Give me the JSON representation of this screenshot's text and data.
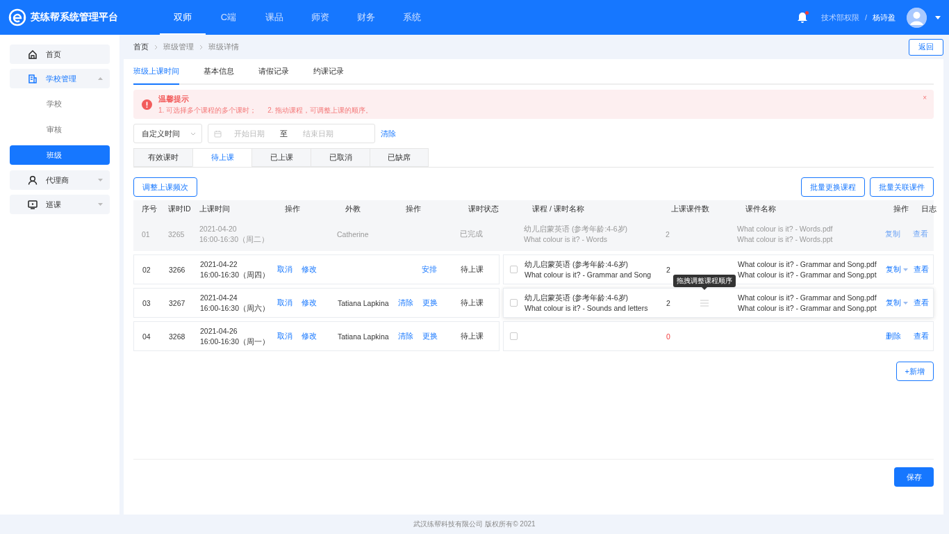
{
  "app": {
    "title": "英练帮系统管理平台"
  },
  "top_nav": [
    {
      "label": "双师",
      "selected": true
    },
    {
      "label": "C端",
      "selected": false
    },
    {
      "label": "课品",
      "selected": false
    },
    {
      "label": "师资",
      "selected": false
    },
    {
      "label": "财务",
      "selected": false
    },
    {
      "label": "系统",
      "selected": false
    }
  ],
  "user": {
    "notifications": true,
    "role": "技术部权限",
    "separator": "/",
    "name": "杨诗盈"
  },
  "sidebar": {
    "items": [
      {
        "label": "首页"
      },
      {
        "label": "学校管理",
        "expanded": true,
        "children": [
          {
            "label": "学校",
            "selected": false
          },
          {
            "label": "审核",
            "selected": false
          },
          {
            "label": "班级",
            "selected": true
          }
        ]
      },
      {
        "label": "代理商",
        "expanded": false
      },
      {
        "label": "巡课",
        "expanded": false
      }
    ]
  },
  "breadcrumb": [
    "首页",
    "班级管理",
    "班级详情"
  ],
  "back_button": "返回",
  "tabs": [
    {
      "label": "班级上课时间",
      "selected": true
    },
    {
      "label": "基本信息",
      "selected": false
    },
    {
      "label": "请假记录",
      "selected": false
    },
    {
      "label": "约课记录",
      "selected": false
    }
  ],
  "alert": {
    "title": "温馨提示",
    "lines": [
      "1. 可选择多个课程的多个课时；",
      "2. 拖动课程，可调整上课的顺序。"
    ],
    "close": "×"
  },
  "filter": {
    "range_select": "自定义时间",
    "start_placeholder": "开始日期",
    "to": "至",
    "end_placeholder": "结束日期",
    "clear": "清除"
  },
  "status_tabs": [
    {
      "label": "有效课时",
      "selected": false
    },
    {
      "label": "待上课",
      "selected": true
    },
    {
      "label": "已上课",
      "selected": false
    },
    {
      "label": "已取消",
      "selected": false
    },
    {
      "label": "已缺席",
      "selected": false
    }
  ],
  "toolbar": {
    "left": "调整上课频次",
    "right": [
      "批量更换课程",
      "批量关联课件"
    ]
  },
  "table": {
    "columns": [
      "序号",
      "课时ID",
      "上课时间",
      "操作",
      "外教",
      "操作",
      "课时状态",
      "课程 / 课时名称",
      "上课课件数",
      "课件名称",
      "操作",
      "日志"
    ],
    "rows": [
      {
        "completed": true,
        "index": "01",
        "id": "3265",
        "date": "2021-04-20",
        "time": "16:00-16:30（周二）",
        "ops": [],
        "teacher": "Catherine",
        "teacher_ops": [],
        "status": "已完成",
        "course": "幼儿启蒙英语 (参考年龄:4-6岁)",
        "lesson": "What colour is it? - Words",
        "count": "2",
        "count_zero": false,
        "files": [
          "What colour is it? - Words.pdf",
          "What colour is it? - Words.ppt"
        ],
        "action": {
          "label": "复制",
          "dropdown": false
        },
        "log": "查看"
      },
      {
        "completed": false,
        "checked": false,
        "index": "02",
        "id": "3266",
        "date": "2021-04-22",
        "time": "16:00-16:30（周四）",
        "ops": [
          "取消",
          "修改"
        ],
        "teacher_ops": [
          "安排"
        ],
        "status": "待上课",
        "course": "幼儿启蒙英语 (参考年龄:4-6岁)",
        "lesson": "What colour is it? - Grammar and Song",
        "count": "2",
        "count_zero": false,
        "files": [
          "What colour is it? - Grammar and Song.pdf",
          "What colour is it? - Grammar and Song.ppt"
        ],
        "action": {
          "label": "复制",
          "dropdown": true
        },
        "log": "查看"
      },
      {
        "completed": false,
        "checked": false,
        "hovered": true,
        "tooltip": "拖拽调整课程顺序",
        "index": "03",
        "id": "3267",
        "date": "2021-04-24",
        "time": "16:00-16:30（周六）",
        "ops": [
          "取消",
          "修改"
        ],
        "teacher": "Tatiana Lapkina",
        "teacher_ops": [
          "清除",
          "更换"
        ],
        "status": "待上课",
        "course": "幼儿启蒙英语 (参考年龄:4-6岁)",
        "lesson": "What colour is it? - Sounds and letters",
        "count": "2",
        "count_zero": false,
        "files": [
          "What colour is it? - Grammar and Song.pdf",
          "What colour is it? - Grammar and Song.ppt"
        ],
        "action": {
          "label": "复制",
          "dropdown": true
        },
        "log": "查看"
      },
      {
        "completed": false,
        "checked": false,
        "index": "04",
        "id": "3268",
        "date": "2021-04-26",
        "time": "16:00-16:30（周一）",
        "ops": [
          "取消",
          "修改"
        ],
        "teacher": "Tatiana Lapkina",
        "teacher_ops": [
          "清除",
          "更换"
        ],
        "status": "待上课",
        "count": "0",
        "count_zero": true,
        "files": [],
        "action": {
          "label": "删除",
          "dropdown": false
        },
        "log": "查看"
      }
    ]
  },
  "add_button": "+新增",
  "save_button": "保存",
  "footer": "武汉练帮科技有限公司 版权所有© 2021"
}
